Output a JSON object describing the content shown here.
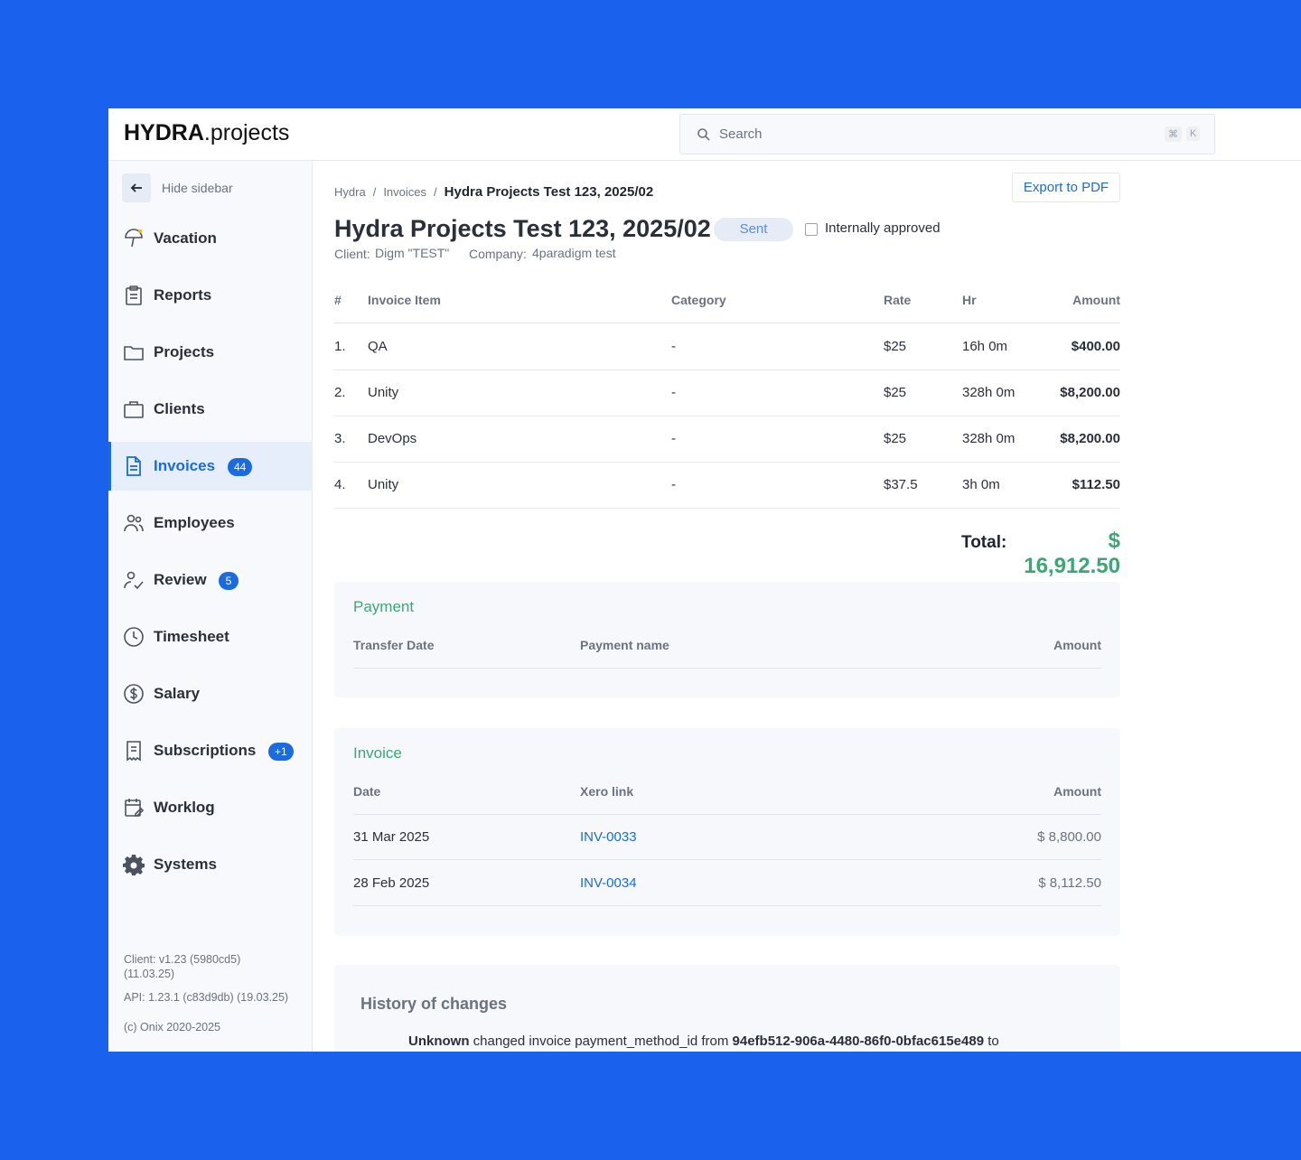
{
  "brand": {
    "bold": "HYDRA",
    "rest": ".projects"
  },
  "search": {
    "placeholder": "Search",
    "shortcut_mod": "⌘",
    "shortcut_key": "K"
  },
  "sidebar": {
    "hide_label": "Hide sidebar",
    "items": [
      {
        "label": "Vacation",
        "icon": "umbrella-icon"
      },
      {
        "label": "Reports",
        "icon": "clipboard-icon"
      },
      {
        "label": "Projects",
        "icon": "folder-icon"
      },
      {
        "label": "Clients",
        "icon": "briefcase-icon"
      },
      {
        "label": "Invoices",
        "icon": "document-icon",
        "badge": "44",
        "active": true
      },
      {
        "label": "Employees",
        "icon": "users-icon"
      },
      {
        "label": "Review",
        "icon": "user-check-icon",
        "badge": "5"
      },
      {
        "label": "Timesheet",
        "icon": "clock-icon"
      },
      {
        "label": "Salary",
        "icon": "dollar-circle-icon"
      },
      {
        "label": "Subscriptions",
        "icon": "receipt-icon",
        "badge": "+1"
      },
      {
        "label": "Worklog",
        "icon": "calendar-edit-icon"
      },
      {
        "label": "Systems",
        "icon": "gear-icon"
      }
    ],
    "footer": {
      "client_version": "Client: v1.23 (5980cd5)",
      "client_date": "(11.03.25)",
      "api_version": "API: 1.23.1 (c83d9db) (19.03.25)",
      "copyright": "(c) Onix 2020-2025"
    }
  },
  "breadcrumb": {
    "root": "Hydra",
    "section": "Invoices",
    "current": "Hydra Projects Test 123, 2025/02",
    "sep": "/"
  },
  "export_label": "Export to PDF",
  "invoice": {
    "title": "Hydra Projects Test 123, 2025/02",
    "status": "Sent",
    "approved_label": "Internally approved",
    "client_label": "Client:",
    "client_name": "Digm \"TEST\"",
    "company_label": "Company:",
    "company_name": "4paradigm test"
  },
  "items_table": {
    "headers": {
      "num": "#",
      "item": "Invoice Item",
      "category": "Category",
      "rate": "Rate",
      "hr": "Hr",
      "amount": "Amount"
    },
    "rows": [
      {
        "num": "1.",
        "item": "QA",
        "category": "-",
        "rate": "$25",
        "hr": "16h 0m",
        "amount": "$400.00"
      },
      {
        "num": "2.",
        "item": "Unity",
        "category": "-",
        "rate": "$25",
        "hr": "328h 0m",
        "amount": "$8,200.00"
      },
      {
        "num": "3.",
        "item": "DevOps",
        "category": "-",
        "rate": "$25",
        "hr": "328h 0m",
        "amount": "$8,200.00"
      },
      {
        "num": "4.",
        "item": "Unity",
        "category": "-",
        "rate": "$37.5",
        "hr": "3h 0m",
        "amount": "$112.50"
      }
    ],
    "total_label": "Total:",
    "total_value": "$ 16,912.50"
  },
  "payment": {
    "title": "Payment",
    "headers": {
      "date": "Transfer Date",
      "name": "Payment name",
      "amount": "Amount"
    }
  },
  "invoice_card": {
    "title": "Invoice",
    "headers": {
      "date": "Date",
      "link": "Xero link",
      "amount": "Amount"
    },
    "rows": [
      {
        "date": "31 Mar 2025",
        "link": "INV-0033",
        "amount": "$ 8,800.00"
      },
      {
        "date": "28 Feb 2025",
        "link": "INV-0034",
        "amount": "$ 8,112.50"
      }
    ]
  },
  "history": {
    "title": "History of changes",
    "entry": {
      "actor": "Unknown",
      "action": " changed invoice payment_method_id from ",
      "from_value": "94efb512-906a-4480-86f0-0bfac615e489",
      "suffix": " to"
    }
  },
  "colors": {
    "background": "#1a62ee",
    "accent": "#1a6be0",
    "success": "#3aa874"
  }
}
